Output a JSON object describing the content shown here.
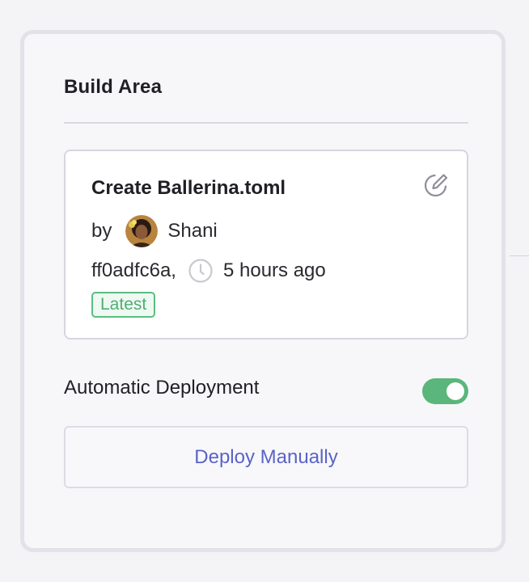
{
  "panel": {
    "title": "Build Area"
  },
  "commit": {
    "title": "Create Ballerina.toml",
    "by_label": "by",
    "author": "Shani",
    "hash": "ff0adfc6a,",
    "time": "5 hours ago",
    "badge": "Latest",
    "edit_icon": "edit-icon",
    "clock_icon": "clock-icon"
  },
  "deployment": {
    "auto_label": "Automatic Deployment",
    "auto_enabled": true,
    "manual_button": "Deploy Manually"
  },
  "colors": {
    "toggle_on": "#5ab67a",
    "badge_green": "#4fae73",
    "link_blue": "#5b63c6"
  }
}
